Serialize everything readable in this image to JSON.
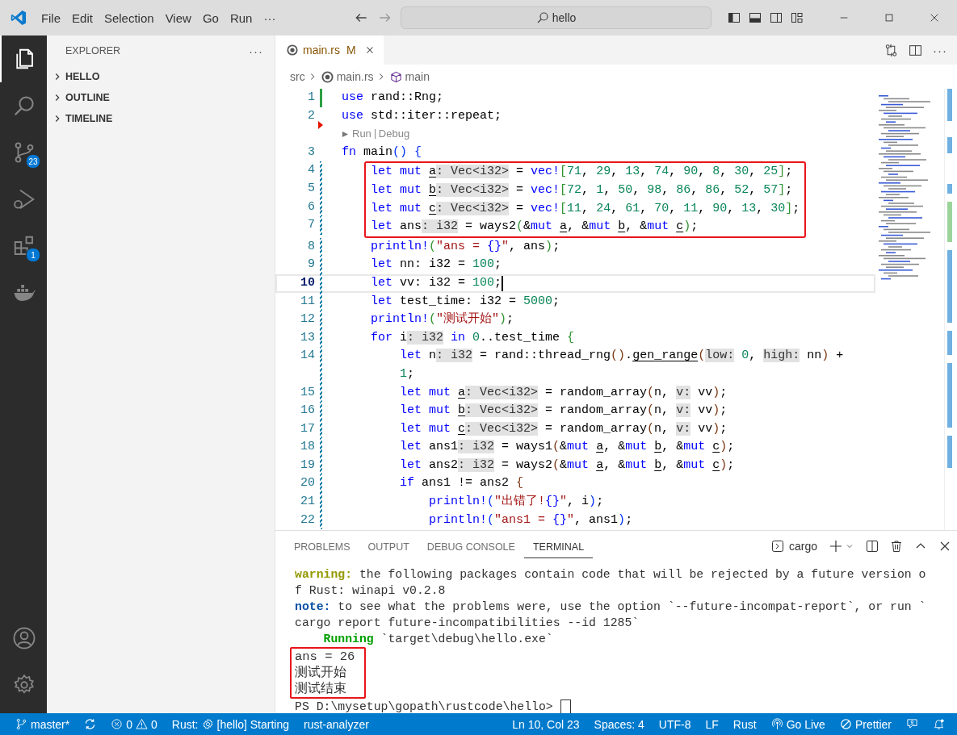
{
  "titlebar": {
    "menus": [
      "File",
      "Edit",
      "Selection",
      "View",
      "Go",
      "Run"
    ],
    "overflow": "···",
    "search": {
      "value": "hello"
    }
  },
  "activity": {
    "items": [
      {
        "kind": "explorer",
        "selected": true
      },
      {
        "kind": "search",
        "selected": false
      },
      {
        "kind": "scm",
        "selected": false,
        "badge": "23"
      },
      {
        "kind": "debug",
        "selected": false
      },
      {
        "kind": "extensions",
        "selected": false,
        "badge": "1"
      },
      {
        "kind": "docker",
        "selected": false
      }
    ],
    "bottom": [
      {
        "kind": "account"
      },
      {
        "kind": "manage"
      }
    ]
  },
  "sidebar": {
    "title": "EXPLORER",
    "overflow": "···",
    "sections": [
      {
        "label": "HELLO",
        "expanded": false
      },
      {
        "label": "OUTLINE",
        "expanded": false
      },
      {
        "label": "TIMELINE",
        "expanded": false
      }
    ]
  },
  "tabs": [
    {
      "label": "main.rs",
      "status": "M",
      "modified": true,
      "selected": true
    }
  ],
  "tab_actions_overflow": "···",
  "breadcrumb": [
    "src",
    "main.rs",
    "main"
  ],
  "editor": {
    "lines": [
      {
        "kind": "code",
        "num": "1",
        "added": true,
        "modified": false,
        "deleted_below": false,
        "boxed": false,
        "current": false,
        "tokens": [
          {
            "kind": "kw",
            "text": "use"
          },
          {
            "kind": "plain",
            "text": " rand::Rng;"
          }
        ]
      },
      {
        "kind": "code",
        "num": "2",
        "added": false,
        "modified": false,
        "deleted_below": true,
        "boxed": false,
        "current": false,
        "tokens": [
          {
            "kind": "kw",
            "text": "use"
          },
          {
            "kind": "plain",
            "text": " std::iter::repeat;"
          }
        ]
      },
      {
        "kind": "lens",
        "items": [
          "Run",
          "Debug"
        ]
      },
      {
        "kind": "code",
        "num": "3",
        "added": false,
        "modified": false,
        "deleted_below": false,
        "boxed": false,
        "current": false,
        "tokens": [
          {
            "kind": "kw",
            "text": "fn"
          },
          {
            "kind": "plain",
            "text": " main"
          },
          {
            "kind": "br1",
            "text": "() {"
          }
        ]
      },
      {
        "kind": "code",
        "num": "4",
        "added": false,
        "modified": true,
        "deleted_below": false,
        "boxed": true,
        "current": false,
        "tokens": [
          {
            "kind": "kw",
            "text": "    let mut "
          },
          {
            "kind": "var",
            "text": "a"
          },
          {
            "kind": "hint",
            "text": ": Vec<i32>"
          },
          {
            "kind": "plain",
            "text": " = "
          },
          {
            "kind": "kw",
            "text": "vec!"
          },
          {
            "kind": "br2",
            "text": "["
          },
          {
            "kind": "num",
            "text": "71"
          },
          {
            "kind": "plain",
            "text": ", "
          },
          {
            "kind": "num",
            "text": "29"
          },
          {
            "kind": "plain",
            "text": ", "
          },
          {
            "kind": "num",
            "text": "13"
          },
          {
            "kind": "plain",
            "text": ", "
          },
          {
            "kind": "num",
            "text": "74"
          },
          {
            "kind": "plain",
            "text": ", "
          },
          {
            "kind": "num",
            "text": "90"
          },
          {
            "kind": "plain",
            "text": ", "
          },
          {
            "kind": "num",
            "text": "8"
          },
          {
            "kind": "plain",
            "text": ", "
          },
          {
            "kind": "num",
            "text": "30"
          },
          {
            "kind": "plain",
            "text": ", "
          },
          {
            "kind": "num",
            "text": "25"
          },
          {
            "kind": "br2",
            "text": "]"
          },
          {
            "kind": "plain",
            "text": ";"
          }
        ]
      },
      {
        "kind": "code",
        "num": "5",
        "added": false,
        "modified": true,
        "deleted_below": false,
        "boxed": true,
        "current": false,
        "tokens": [
          {
            "kind": "kw",
            "text": "    let mut "
          },
          {
            "kind": "var",
            "text": "b"
          },
          {
            "kind": "hint",
            "text": ": Vec<i32>"
          },
          {
            "kind": "plain",
            "text": " = "
          },
          {
            "kind": "kw",
            "text": "vec!"
          },
          {
            "kind": "br2",
            "text": "["
          },
          {
            "kind": "num",
            "text": "72"
          },
          {
            "kind": "plain",
            "text": ", "
          },
          {
            "kind": "num",
            "text": "1"
          },
          {
            "kind": "plain",
            "text": ", "
          },
          {
            "kind": "num",
            "text": "50"
          },
          {
            "kind": "plain",
            "text": ", "
          },
          {
            "kind": "num",
            "text": "98"
          },
          {
            "kind": "plain",
            "text": ", "
          },
          {
            "kind": "num",
            "text": "86"
          },
          {
            "kind": "plain",
            "text": ", "
          },
          {
            "kind": "num",
            "text": "86"
          },
          {
            "kind": "plain",
            "text": ", "
          },
          {
            "kind": "num",
            "text": "52"
          },
          {
            "kind": "plain",
            "text": ", "
          },
          {
            "kind": "num",
            "text": "57"
          },
          {
            "kind": "br2",
            "text": "]"
          },
          {
            "kind": "plain",
            "text": ";"
          }
        ]
      },
      {
        "kind": "code",
        "num": "6",
        "added": false,
        "modified": true,
        "deleted_below": false,
        "boxed": true,
        "current": false,
        "tokens": [
          {
            "kind": "kw",
            "text": "    let mut "
          },
          {
            "kind": "var",
            "text": "c"
          },
          {
            "kind": "hint",
            "text": ": Vec<i32>"
          },
          {
            "kind": "plain",
            "text": " = "
          },
          {
            "kind": "kw",
            "text": "vec!"
          },
          {
            "kind": "br2",
            "text": "["
          },
          {
            "kind": "num",
            "text": "11"
          },
          {
            "kind": "plain",
            "text": ", "
          },
          {
            "kind": "num",
            "text": "24"
          },
          {
            "kind": "plain",
            "text": ", "
          },
          {
            "kind": "num",
            "text": "61"
          },
          {
            "kind": "plain",
            "text": ", "
          },
          {
            "kind": "num",
            "text": "70"
          },
          {
            "kind": "plain",
            "text": ", "
          },
          {
            "kind": "num",
            "text": "11"
          },
          {
            "kind": "plain",
            "text": ", "
          },
          {
            "kind": "num",
            "text": "90"
          },
          {
            "kind": "plain",
            "text": ", "
          },
          {
            "kind": "num",
            "text": "13"
          },
          {
            "kind": "plain",
            "text": ", "
          },
          {
            "kind": "num",
            "text": "30"
          },
          {
            "kind": "br2",
            "text": "]"
          },
          {
            "kind": "plain",
            "text": ";"
          }
        ]
      },
      {
        "kind": "code",
        "num": "7",
        "added": false,
        "modified": true,
        "deleted_below": false,
        "boxed": true,
        "current": false,
        "tokens": [
          {
            "kind": "kw",
            "text": "    let"
          },
          {
            "kind": "plain",
            "text": " ans"
          },
          {
            "kind": "hint",
            "text": ": i32"
          },
          {
            "kind": "plain",
            "text": " = ways2"
          },
          {
            "kind": "br2",
            "text": "("
          },
          {
            "kind": "plain",
            "text": "&"
          },
          {
            "kind": "kw",
            "text": "mut "
          },
          {
            "kind": "var",
            "text": "a"
          },
          {
            "kind": "plain",
            "text": ", &"
          },
          {
            "kind": "kw",
            "text": "mut "
          },
          {
            "kind": "var",
            "text": "b"
          },
          {
            "kind": "plain",
            "text": ", &"
          },
          {
            "kind": "kw",
            "text": "mut "
          },
          {
            "kind": "var",
            "text": "c"
          },
          {
            "kind": "br2",
            "text": ")"
          },
          {
            "kind": "plain",
            "text": ";"
          }
        ]
      },
      {
        "kind": "code",
        "num": "8",
        "added": false,
        "modified": true,
        "deleted_below": false,
        "boxed": false,
        "current": false,
        "tokens": [
          {
            "kind": "kw",
            "text": "    println!"
          },
          {
            "kind": "br2",
            "text": "("
          },
          {
            "kind": "str",
            "text": "\"ans = "
          },
          {
            "kind": "kw",
            "text": "{}"
          },
          {
            "kind": "str",
            "text": "\""
          },
          {
            "kind": "plain",
            "text": ", ans"
          },
          {
            "kind": "br2",
            "text": ")"
          },
          {
            "kind": "plain",
            "text": ";"
          }
        ]
      },
      {
        "kind": "code",
        "num": "9",
        "added": false,
        "modified": true,
        "deleted_below": false,
        "boxed": false,
        "current": false,
        "tokens": [
          {
            "kind": "kw",
            "text": "    let"
          },
          {
            "kind": "plain",
            "text": " nn: i32 = "
          },
          {
            "kind": "num",
            "text": "100"
          },
          {
            "kind": "plain",
            "text": ";"
          }
        ]
      },
      {
        "kind": "code",
        "num": "10",
        "added": false,
        "modified": true,
        "deleted_below": false,
        "boxed": false,
        "current": true,
        "tokens": [
          {
            "kind": "kw",
            "text": "    let"
          },
          {
            "kind": "plain",
            "text": " vv: i32 = "
          },
          {
            "kind": "num",
            "text": "100"
          },
          {
            "kind": "plain",
            "text": ";"
          }
        ]
      },
      {
        "kind": "code",
        "num": "11",
        "added": false,
        "modified": true,
        "deleted_below": false,
        "boxed": false,
        "current": false,
        "tokens": [
          {
            "kind": "kw",
            "text": "    let"
          },
          {
            "kind": "plain",
            "text": " test_time: i32 = "
          },
          {
            "kind": "num",
            "text": "5000"
          },
          {
            "kind": "plain",
            "text": ";"
          }
        ]
      },
      {
        "kind": "code",
        "num": "12",
        "added": false,
        "modified": true,
        "deleted_below": false,
        "boxed": false,
        "current": false,
        "tokens": [
          {
            "kind": "kw",
            "text": "    println!"
          },
          {
            "kind": "br2",
            "text": "("
          },
          {
            "kind": "str",
            "text": "\"测试开始\""
          },
          {
            "kind": "br2",
            "text": ")"
          },
          {
            "kind": "plain",
            "text": ";"
          }
        ]
      },
      {
        "kind": "code",
        "num": "13",
        "added": false,
        "modified": true,
        "deleted_below": false,
        "boxed": false,
        "current": false,
        "tokens": [
          {
            "kind": "kw",
            "text": "    for"
          },
          {
            "kind": "plain",
            "text": " i"
          },
          {
            "kind": "hint",
            "text": ": i32"
          },
          {
            "kind": "kw",
            "text": " in "
          },
          {
            "kind": "num",
            "text": "0"
          },
          {
            "kind": "plain",
            "text": "..test_time "
          },
          {
            "kind": "br2",
            "text": "{"
          }
        ]
      },
      {
        "kind": "code",
        "num": "14",
        "added": false,
        "modified": true,
        "deleted_below": false,
        "boxed": false,
        "current": false,
        "tokens": [
          {
            "kind": "kw",
            "text": "        let"
          },
          {
            "kind": "plain",
            "text": " n"
          },
          {
            "kind": "hint",
            "text": ": i32"
          },
          {
            "kind": "plain",
            "text": " = rand::thread_rng"
          },
          {
            "kind": "br3",
            "text": "()"
          },
          {
            "kind": "plain",
            "text": "."
          },
          {
            "kind": "var",
            "text": "gen_range"
          },
          {
            "kind": "br3",
            "text": "("
          },
          {
            "kind": "hint",
            "text": "low:"
          },
          {
            "kind": "num",
            "text": " 0"
          },
          {
            "kind": "plain",
            "text": ", "
          },
          {
            "kind": "hint",
            "text": "high:"
          },
          {
            "kind": "plain",
            "text": " nn"
          },
          {
            "kind": "br3",
            "text": ")"
          },
          {
            "kind": "plain",
            "text": " +"
          }
        ],
        "cont": [
          {
            "kind": "num",
            "text": "        1"
          },
          {
            "kind": "plain",
            "text": ";"
          }
        ]
      },
      {
        "kind": "code",
        "num": "15",
        "added": false,
        "modified": true,
        "deleted_below": false,
        "boxed": false,
        "current": false,
        "tokens": [
          {
            "kind": "kw",
            "text": "        let mut "
          },
          {
            "kind": "var",
            "text": "a"
          },
          {
            "kind": "hint",
            "text": ": Vec<i32>"
          },
          {
            "kind": "plain",
            "text": " = random_array"
          },
          {
            "kind": "br3",
            "text": "("
          },
          {
            "kind": "plain",
            "text": "n, "
          },
          {
            "kind": "hint",
            "text": "v:"
          },
          {
            "kind": "plain",
            "text": " vv"
          },
          {
            "kind": "br3",
            "text": ")"
          },
          {
            "kind": "plain",
            "text": ";"
          }
        ]
      },
      {
        "kind": "code",
        "num": "16",
        "added": false,
        "modified": true,
        "deleted_below": false,
        "boxed": false,
        "current": false,
        "tokens": [
          {
            "kind": "kw",
            "text": "        let mut "
          },
          {
            "kind": "var",
            "text": "b"
          },
          {
            "kind": "hint",
            "text": ": Vec<i32>"
          },
          {
            "kind": "plain",
            "text": " = random_array"
          },
          {
            "kind": "br3",
            "text": "("
          },
          {
            "kind": "plain",
            "text": "n, "
          },
          {
            "kind": "hint",
            "text": "v:"
          },
          {
            "kind": "plain",
            "text": " vv"
          },
          {
            "kind": "br3",
            "text": ")"
          },
          {
            "kind": "plain",
            "text": ";"
          }
        ]
      },
      {
        "kind": "code",
        "num": "17",
        "added": false,
        "modified": true,
        "deleted_below": false,
        "boxed": false,
        "current": false,
        "tokens": [
          {
            "kind": "kw",
            "text": "        let mut "
          },
          {
            "kind": "var",
            "text": "c"
          },
          {
            "kind": "hint",
            "text": ": Vec<i32>"
          },
          {
            "kind": "plain",
            "text": " = random_array"
          },
          {
            "kind": "br3",
            "text": "("
          },
          {
            "kind": "plain",
            "text": "n, "
          },
          {
            "kind": "hint",
            "text": "v:"
          },
          {
            "kind": "plain",
            "text": " vv"
          },
          {
            "kind": "br3",
            "text": ")"
          },
          {
            "kind": "plain",
            "text": ";"
          }
        ]
      },
      {
        "kind": "code",
        "num": "18",
        "added": false,
        "modified": true,
        "deleted_below": false,
        "boxed": false,
        "current": false,
        "tokens": [
          {
            "kind": "kw",
            "text": "        let"
          },
          {
            "kind": "plain",
            "text": " ans1"
          },
          {
            "kind": "hint",
            "text": ": i32"
          },
          {
            "kind": "plain",
            "text": " = ways1"
          },
          {
            "kind": "br3",
            "text": "("
          },
          {
            "kind": "plain",
            "text": "&"
          },
          {
            "kind": "kw",
            "text": "mut "
          },
          {
            "kind": "var",
            "text": "a"
          },
          {
            "kind": "plain",
            "text": ", &"
          },
          {
            "kind": "kw",
            "text": "mut "
          },
          {
            "kind": "var",
            "text": "b"
          },
          {
            "kind": "plain",
            "text": ", &"
          },
          {
            "kind": "kw",
            "text": "mut "
          },
          {
            "kind": "var",
            "text": "c"
          },
          {
            "kind": "br3",
            "text": ")"
          },
          {
            "kind": "plain",
            "text": ";"
          }
        ]
      },
      {
        "kind": "code",
        "num": "19",
        "added": false,
        "modified": true,
        "deleted_below": false,
        "boxed": false,
        "current": false,
        "tokens": [
          {
            "kind": "kw",
            "text": "        let"
          },
          {
            "kind": "plain",
            "text": " ans2"
          },
          {
            "kind": "hint",
            "text": ": i32"
          },
          {
            "kind": "plain",
            "text": " = ways2"
          },
          {
            "kind": "br3",
            "text": "("
          },
          {
            "kind": "plain",
            "text": "&"
          },
          {
            "kind": "kw",
            "text": "mut "
          },
          {
            "kind": "var",
            "text": "a"
          },
          {
            "kind": "plain",
            "text": ", &"
          },
          {
            "kind": "kw",
            "text": "mut "
          },
          {
            "kind": "var",
            "text": "b"
          },
          {
            "kind": "plain",
            "text": ", &"
          },
          {
            "kind": "kw",
            "text": "mut "
          },
          {
            "kind": "var",
            "text": "c"
          },
          {
            "kind": "br3",
            "text": ")"
          },
          {
            "kind": "plain",
            "text": ";"
          }
        ]
      },
      {
        "kind": "code",
        "num": "20",
        "added": false,
        "modified": true,
        "deleted_below": false,
        "boxed": false,
        "current": false,
        "tokens": [
          {
            "kind": "kw",
            "text": "        if"
          },
          {
            "kind": "plain",
            "text": " ans1 != ans2 "
          },
          {
            "kind": "br3",
            "text": "{"
          }
        ]
      },
      {
        "kind": "code",
        "num": "21",
        "added": false,
        "modified": true,
        "deleted_below": false,
        "boxed": false,
        "current": false,
        "tokens": [
          {
            "kind": "kw",
            "text": "            println!"
          },
          {
            "kind": "br1",
            "text": "("
          },
          {
            "kind": "str",
            "text": "\"出错了!"
          },
          {
            "kind": "kw",
            "text": "{}"
          },
          {
            "kind": "str",
            "text": "\""
          },
          {
            "kind": "plain",
            "text": ", i"
          },
          {
            "kind": "br1",
            "text": ")"
          },
          {
            "kind": "plain",
            "text": ";"
          }
        ]
      },
      {
        "kind": "code",
        "num": "22",
        "added": false,
        "modified": true,
        "deleted_below": false,
        "boxed": false,
        "current": false,
        "tokens": [
          {
            "kind": "kw",
            "text": "            println!"
          },
          {
            "kind": "br1",
            "text": "("
          },
          {
            "kind": "str",
            "text": "\"ans1 = "
          },
          {
            "kind": "kw",
            "text": "{}"
          },
          {
            "kind": "str",
            "text": "\""
          },
          {
            "kind": "plain",
            "text": ", ans1"
          },
          {
            "kind": "br1",
            "text": ")"
          },
          {
            "kind": "plain",
            "text": ";"
          }
        ]
      }
    ]
  },
  "panel": {
    "tabs": [
      {
        "label": "PROBLEMS",
        "selected": false
      },
      {
        "label": "OUTPUT",
        "selected": false
      },
      {
        "label": "DEBUG CONSOLE",
        "selected": false
      },
      {
        "label": "TERMINAL",
        "selected": true
      }
    ],
    "terminal_name": "cargo",
    "lines": [
      {
        "boxed": false,
        "tokens": [
          {
            "kind": "warn",
            "text": "warning:"
          },
          {
            "kind": "plain",
            "text": " the following packages contain code that will be rejected by a future version o"
          }
        ]
      },
      {
        "boxed": false,
        "tokens": [
          {
            "kind": "plain",
            "text": "f Rust: winapi v0.2.8"
          }
        ]
      },
      {
        "boxed": false,
        "tokens": [
          {
            "kind": "note",
            "text": "note:"
          },
          {
            "kind": "plain",
            "text": " to see what the problems were, use the option `--future-incompat-report`, or run `"
          }
        ]
      },
      {
        "boxed": false,
        "tokens": [
          {
            "kind": "plain",
            "text": "cargo report future-incompatibilities --id 1285`"
          }
        ]
      },
      {
        "boxed": false,
        "tokens": [
          {
            "kind": "run",
            "text": "    Running"
          },
          {
            "kind": "plain",
            "text": " `target\\debug\\hello.exe`"
          }
        ]
      },
      {
        "boxed": true,
        "tokens": [
          {
            "kind": "plain",
            "text": "ans = 26"
          }
        ]
      },
      {
        "boxed": true,
        "tokens": [
          {
            "kind": "plain",
            "text": "测试开始"
          }
        ]
      },
      {
        "boxed": true,
        "tokens": [
          {
            "kind": "plain",
            "text": "测试结束"
          }
        ]
      }
    ],
    "prompt": "PS D:\\mysetup\\gopath\\rustcode\\hello>"
  },
  "status": {
    "left": [
      {
        "kind": "branch",
        "text": "master*"
      },
      {
        "kind": "sync"
      },
      {
        "kind": "problems",
        "errors": "0",
        "warnings": "0"
      },
      {
        "kind": "rust",
        "label": "Rust:",
        "text": "[hello] Starting"
      },
      {
        "kind": "plain",
        "text": "rust-analyzer"
      }
    ],
    "right": [
      {
        "kind": "plain",
        "text": "Ln 10, Col 23"
      },
      {
        "kind": "plain",
        "text": "Spaces: 4"
      },
      {
        "kind": "plain",
        "text": "UTF-8"
      },
      {
        "kind": "plain",
        "text": "LF"
      },
      {
        "kind": "plain",
        "text": "Rust"
      },
      {
        "kind": "golive",
        "text": "Go Live"
      },
      {
        "kind": "prettier",
        "text": "Prettier"
      },
      {
        "kind": "feedback"
      },
      {
        "kind": "bell"
      }
    ]
  }
}
